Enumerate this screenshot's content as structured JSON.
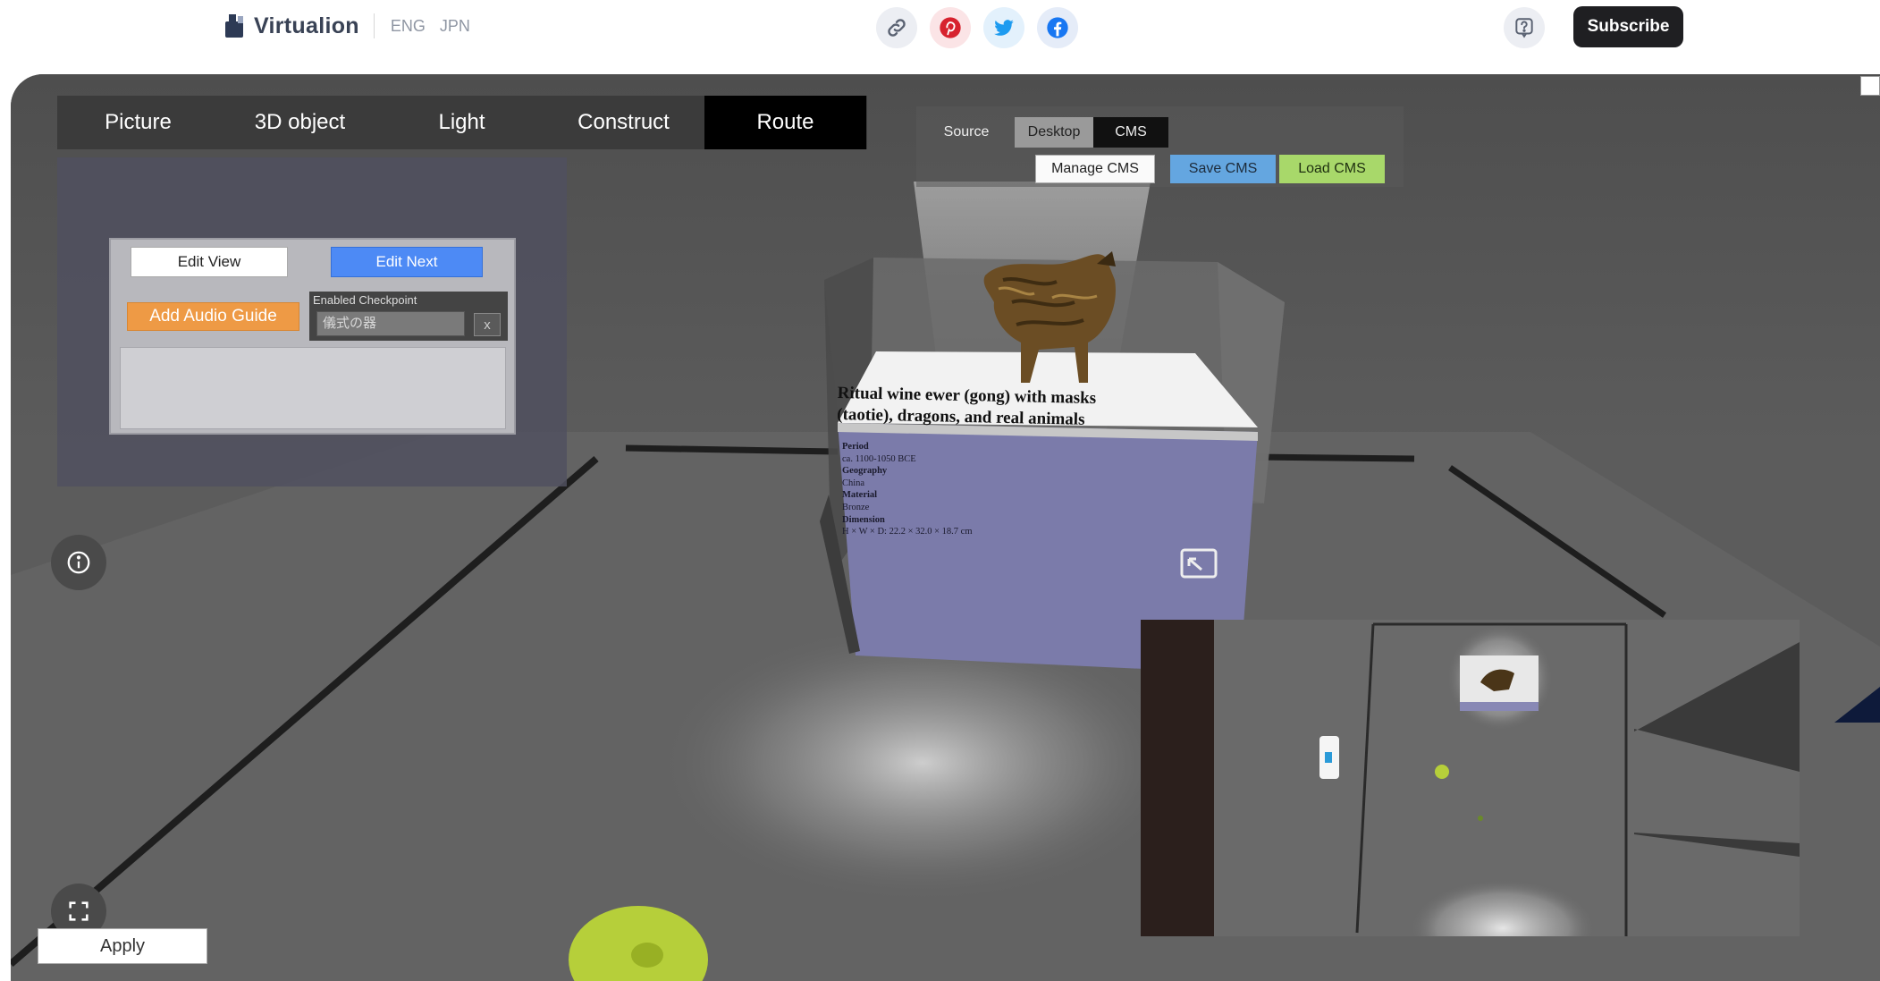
{
  "header": {
    "brand_name": "Virtualion",
    "languages": [
      "ENG",
      "JPN"
    ],
    "subscribe_label": "Subscribe"
  },
  "share_icons": [
    "link-icon",
    "pinterest-icon",
    "twitter-icon",
    "facebook-icon"
  ],
  "toolbar": {
    "tabs": [
      {
        "label": "Picture",
        "active": false
      },
      {
        "label": "3D object",
        "active": false
      },
      {
        "label": "Light",
        "active": false
      },
      {
        "label": "Construct",
        "active": false
      },
      {
        "label": "Route",
        "active": true
      }
    ]
  },
  "route_panel": {
    "edit_view_label": "Edit View",
    "edit_next_label": "Edit Next",
    "audio_guide_label": "Add Audio Guide",
    "checkpoint_label": "Enabled Checkpoint",
    "checkpoint_value": "儀式の器",
    "checkpoint_clear": "x",
    "apply_label": "Apply"
  },
  "cms_panel": {
    "tabs": [
      {
        "label": "Source",
        "active": false
      },
      {
        "label": "Desktop",
        "active": false
      },
      {
        "label": "CMS",
        "active": true
      }
    ],
    "manage_label": "Manage CMS",
    "save_label": "Save CMS",
    "load_label": "Load CMS"
  },
  "exhibit": {
    "title_line1": "Ritual wine ewer (gong) with masks",
    "title_line2": "(taotie), dragons, and real animals",
    "details": [
      "Period",
      "ca. 1100-1050 BCE",
      "Geography",
      "China",
      "Material",
      "Bronze",
      "Dimension",
      "H × W × D: 22.2 × 32.0 × 18.7 cm"
    ]
  },
  "colors": {
    "accent_blue": "#4d8af5",
    "audio_orange": "#ee9a45",
    "save_blue": "#64a6e0",
    "load_green": "#a8d86a",
    "pedestal_lavender": "#7a7aa8",
    "marker_yellow": "#b8d23a"
  }
}
